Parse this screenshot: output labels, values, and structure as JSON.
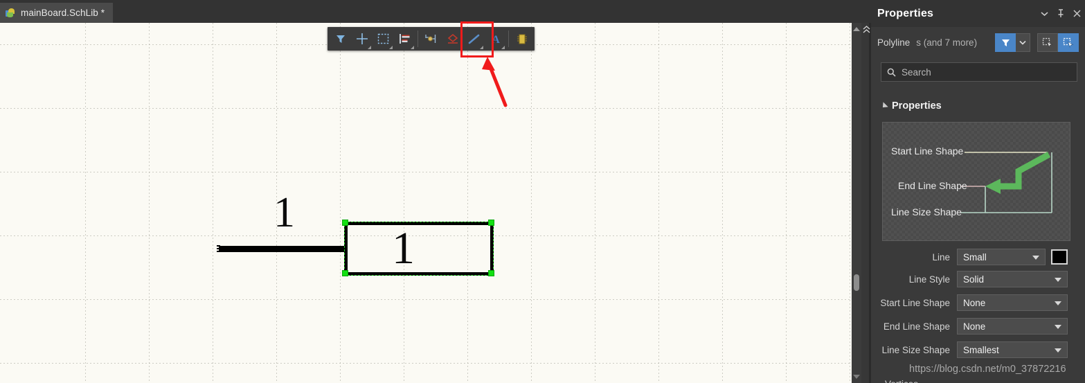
{
  "tab": {
    "label": "mainBoard.SchLib *",
    "icon": "schematic-library-icon"
  },
  "toolbar": {
    "buttons": [
      {
        "name": "filter-tool",
        "icon": "funnel-icon",
        "caret": false
      },
      {
        "name": "place-crosshair-tool",
        "icon": "crosshair-icon",
        "caret": true
      },
      {
        "name": "area-select-tool",
        "icon": "dashed-rect-icon",
        "caret": true
      },
      {
        "name": "align-tool",
        "icon": "align-left-icon",
        "caret": true
      },
      {
        "name": "place-pin-tool",
        "icon": "pin-icon",
        "caret": false
      },
      {
        "name": "place-net-tool",
        "icon": "diamond-net-icon",
        "caret": false
      },
      {
        "name": "place-line-tool",
        "icon": "diagonal-line-icon",
        "caret": true
      },
      {
        "name": "place-text-tool",
        "icon": "text-a-icon",
        "caret": true
      },
      {
        "name": "place-component-tool",
        "icon": "ic-chip-icon",
        "caret": false
      }
    ],
    "highlighted_tool": "place-line-tool"
  },
  "canvas": {
    "pin_number": "1",
    "rect_number": "1",
    "selection_handles": 4
  },
  "panel": {
    "title": "Properties",
    "title_actions": [
      {
        "name": "panel-menu-button",
        "icon": "chevron-down-icon"
      },
      {
        "name": "panel-pin-button",
        "icon": "pin-icon"
      },
      {
        "name": "panel-close-button",
        "icon": "close-icon"
      }
    ],
    "object_name": "Polyline",
    "object_more": "s (and 7 more)",
    "filter_button": {
      "name": "filter-button",
      "icon": "funnel-icon"
    },
    "filter_caret": {
      "name": "filter-dropdown",
      "icon": "chevron-down-icon"
    },
    "select_buttons": [
      {
        "name": "select-mode-normal-button",
        "icon": "cursor-select-icon",
        "active": false
      },
      {
        "name": "select-mode-touch-button",
        "icon": "cursor-select-icon",
        "active": true
      }
    ],
    "search": {
      "placeholder": "Search",
      "value": "",
      "icon": "search-icon"
    },
    "section": {
      "title": "Properties",
      "expanded": true
    },
    "preview": {
      "labels": [
        "Start Line Shape",
        "End Line Shape",
        "Line Size Shape"
      ],
      "line_color": "#5cb85c",
      "leader_colors": [
        "#e8e8c8",
        "#d8b8b8",
        "#b8d8c8"
      ]
    },
    "fields": [
      {
        "label": "Line",
        "value": "Small",
        "width": "short",
        "swatch": "#000000"
      },
      {
        "label": "Line Style",
        "value": "Solid",
        "width": "long",
        "swatch": null
      },
      {
        "label": "Start Line Shape",
        "value": "None",
        "width": "long",
        "swatch": null
      },
      {
        "label": "End Line Shape",
        "value": "None",
        "width": "long",
        "swatch": null
      },
      {
        "label": "Line Size Shape",
        "value": "Smallest",
        "width": "long",
        "swatch": null
      }
    ],
    "watermark": "https://blog.csdn.net/m0_37872216",
    "cut_off_text": "Vertices"
  },
  "scrollbar": {
    "up_arrow": "triangle-up-icon",
    "down_arrow": "triangle-down-icon",
    "collapse_icon": "double-chevron-up-icon"
  },
  "colors": {
    "accent_blue": "#4a86c8",
    "highlight_red": "#f01b1b",
    "selection_green": "#13e013",
    "canvas_bg": "#fbfaf4",
    "panel_bg": "#3a3a3a"
  }
}
